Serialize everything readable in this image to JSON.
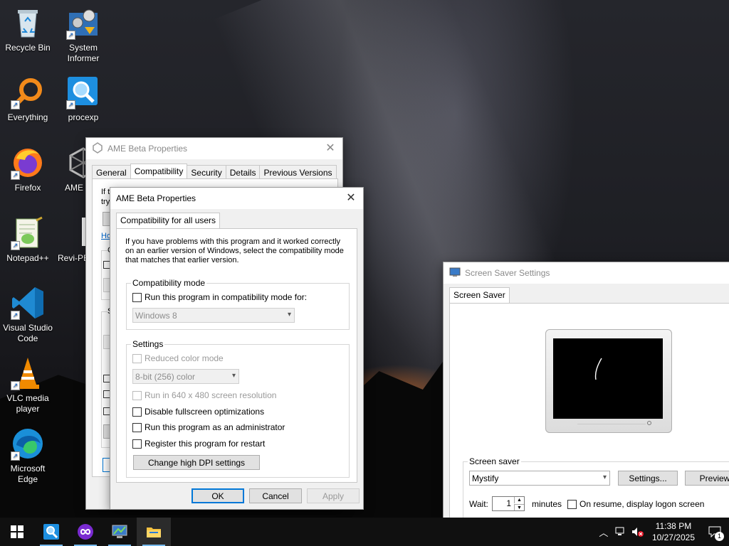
{
  "desktop": {
    "icons": [
      {
        "label": "Recycle Bin",
        "icon": "recycle-bin-icon"
      },
      {
        "label": "System Informer",
        "icon": "system-informer-icon"
      },
      {
        "label": "Everything",
        "icon": "everything-search-icon"
      },
      {
        "label": "procexp",
        "icon": "procexp-icon"
      },
      {
        "label": "Firefox",
        "icon": "firefox-icon"
      },
      {
        "label": "AME",
        "icon": "ame-icon"
      },
      {
        "label": "Notepad++",
        "icon": "notepadpp-icon"
      },
      {
        "label": "Revi-PB",
        "icon": "file-icon"
      },
      {
        "label": "Visual Studio Code",
        "icon": "vscode-icon"
      },
      {
        "label": "VLC media player",
        "icon": "vlc-icon"
      },
      {
        "label": "Microsoft Edge",
        "icon": "edge-icon"
      }
    ]
  },
  "back_window": {
    "title": "AME Beta Properties",
    "tabs": [
      "General",
      "Compatibility",
      "Security",
      "Details",
      "Previous Versions"
    ],
    "active_tab": "Compatibility",
    "partial_text": [
      "If t",
      "try",
      "Ho",
      "C",
      "S"
    ]
  },
  "dialog": {
    "title": "AME Beta Properties",
    "tab": "Compatibility for all users",
    "intro": "If you have problems with this program and it worked correctly on an earlier version of Windows, select the compatibility mode that matches that earlier version.",
    "compat_group": {
      "title": "Compatibility mode",
      "checkbox": "Run this program in compatibility mode for:",
      "select_value": "Windows 8"
    },
    "settings_group": {
      "title": "Settings",
      "reduced_color": "Reduced color mode",
      "color_select": "8-bit (256) color",
      "res_640": "Run in 640 x 480 screen resolution",
      "disable_fullscreen": "Disable fullscreen optimizations",
      "run_admin": "Run this program as an administrator",
      "register_restart": "Register this program for restart",
      "dpi_button": "Change high DPI settings"
    },
    "buttons": {
      "ok": "OK",
      "cancel": "Cancel",
      "apply": "Apply"
    }
  },
  "screensaver": {
    "title": "Screen Saver Settings",
    "tab": "Screen Saver",
    "group_title": "Screen saver",
    "selected": "Mystify",
    "settings_button": "Settings...",
    "preview_button": "Preview",
    "wait_label": "Wait:",
    "wait_value": "1",
    "minutes_label": "minutes",
    "resume_label": "On resume, display logon screen"
  },
  "taskbar": {
    "apps": [
      "start-icon",
      "procexp-icon",
      "ame-taskbar-icon",
      "system-settings-icon",
      "file-explorer-icon"
    ],
    "time": "11:38 PM",
    "date": "10/27/2025",
    "notification_count": "1"
  },
  "colors": {
    "accent": "#0078d7",
    "taskbar": "#101010",
    "dialog_bg": "#f0f0f0"
  }
}
